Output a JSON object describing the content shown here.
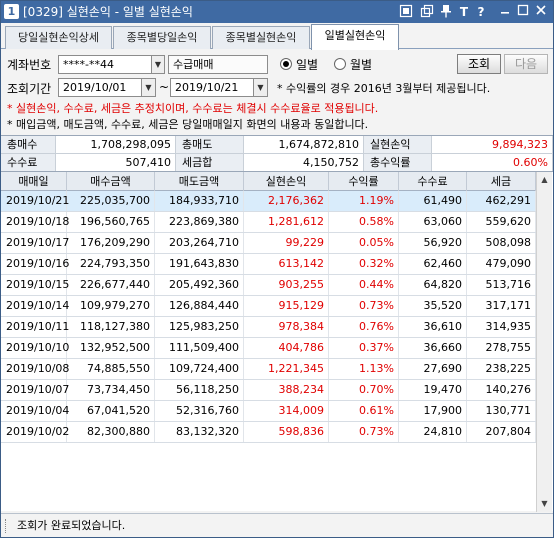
{
  "window": {
    "screen_no": "1",
    "title": "[0329] 실현손익 - 일별 실현손익"
  },
  "tabs": [
    {
      "label": "당일실현손익상세"
    },
    {
      "label": "종목별당일손익"
    },
    {
      "label": "종목별실현손익"
    },
    {
      "label": "일별실현손익"
    }
  ],
  "controls": {
    "account_label": "계좌번호",
    "account_value": "****-**44",
    "account_name": "수급매매",
    "radio_daily": "일별",
    "radio_monthly": "월별",
    "query_button": "조회",
    "next_button": "다음",
    "period_label": "조회기간",
    "date_from": "2019/10/01",
    "date_sep": "~",
    "date_to": "2019/10/21",
    "info_line": "* 수익률의 경우 2016년 3월부터 제공됩니다.",
    "warn_line": "* 실현손익, 수수료, 세금은 추정치이며, 수수료는 체결시 수수료율로 적용됩니다.",
    "note_line": "* 매입금액, 매도금액, 수수료, 세금은 당일매매일지 화면의 내용과 동일합니다."
  },
  "summary": {
    "total_buy_label": "총매수",
    "total_buy": "1,708,298,095",
    "total_sell_label": "총매도",
    "total_sell": "1,674,872,810",
    "realized_label": "실현손익",
    "realized": "9,894,323",
    "fee_label": "수수료",
    "fee": "507,410",
    "tax_label": "세금합",
    "tax": "4,150,752",
    "return_label": "총수익률",
    "return": "0.60%"
  },
  "grid": {
    "columns": [
      "매매일",
      "매수금액",
      "매도금액",
      "실현손익",
      "수익률",
      "수수료",
      "세금"
    ],
    "rows": [
      [
        "2019/10/21",
        "225,035,700",
        "184,933,710",
        "2,176,362",
        "1.19%",
        "61,490",
        "462,291"
      ],
      [
        "2019/10/18",
        "196,560,765",
        "223,869,380",
        "1,281,612",
        "0.58%",
        "63,060",
        "559,620"
      ],
      [
        "2019/10/17",
        "176,209,290",
        "203,264,710",
        "99,229",
        "0.05%",
        "56,920",
        "508,098"
      ],
      [
        "2019/10/16",
        "224,793,350",
        "191,643,830",
        "613,142",
        "0.32%",
        "62,460",
        "479,090"
      ],
      [
        "2019/10/15",
        "226,677,440",
        "205,492,360",
        "903,255",
        "0.44%",
        "64,820",
        "513,716"
      ],
      [
        "2019/10/14",
        "109,979,270",
        "126,884,440",
        "915,129",
        "0.73%",
        "35,520",
        "317,171"
      ],
      [
        "2019/10/11",
        "118,127,380",
        "125,983,250",
        "978,384",
        "0.76%",
        "36,610",
        "314,935"
      ],
      [
        "2019/10/10",
        "132,952,500",
        "111,509,400",
        "404,786",
        "0.37%",
        "36,660",
        "278,755"
      ],
      [
        "2019/10/08",
        "74,885,550",
        "109,724,400",
        "1,221,345",
        "1.13%",
        "27,690",
        "238,225"
      ],
      [
        "2019/10/07",
        "73,734,450",
        "56,118,250",
        "388,234",
        "0.70%",
        "19,470",
        "140,276"
      ],
      [
        "2019/10/04",
        "67,041,520",
        "52,316,760",
        "314,009",
        "0.61%",
        "17,900",
        "130,771"
      ],
      [
        "2019/10/02",
        "82,300,880",
        "83,132,320",
        "598,836",
        "0.73%",
        "24,810",
        "207,804"
      ]
    ]
  },
  "status": {
    "text": "조회가 완료되었습니다."
  },
  "icons": [
    "screen-number-icon",
    "dock-icon",
    "copy-window-icon",
    "pin-icon",
    "font-size-icon",
    "help-icon",
    "minimize-icon",
    "maximize-icon",
    "close-icon"
  ],
  "colors": {
    "titlebar": "#3f6aa3",
    "profit_red": "#e00000",
    "selected_row": "#d9ecfb"
  }
}
